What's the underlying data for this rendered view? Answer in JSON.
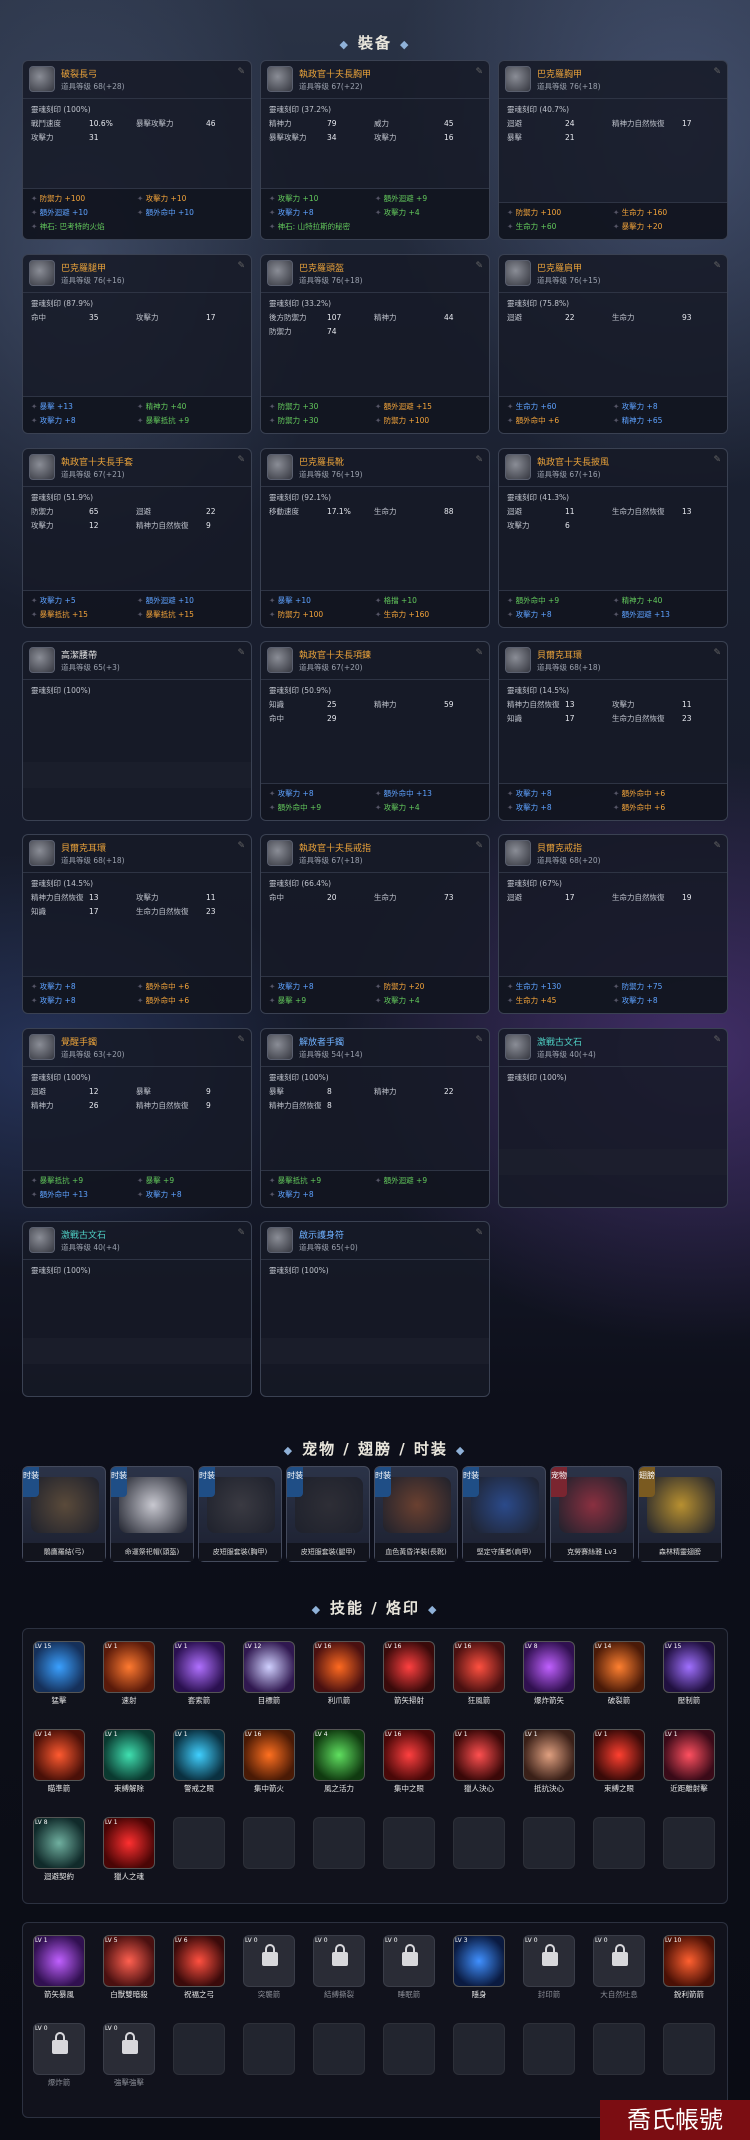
{
  "sections": {
    "equipment": "裝备",
    "pets": "宠物 / 翅膀 / 时装",
    "skills": "技能 / 烙印"
  },
  "cards": [
    {
      "name": "破裂長弓",
      "color": "orange",
      "level_label": "道具等级",
      "level": "68(+28)",
      "rune_pct": "靈魂刻印 (100%)",
      "stats": [
        [
          "戰鬥速度",
          "10.6%",
          "暴擊攻擊力",
          "46"
        ],
        [
          "攻擊力",
          "31",
          "",
          ""
        ]
      ],
      "bonus": [
        [
          "o",
          "防禦力 +100"
        ],
        [
          "o",
          "攻擊力 +10"
        ],
        [
          "bl",
          "額外迴避 +10"
        ],
        [
          "bl",
          "額外命中 +10"
        ],
        [
          "g",
          "神石: 巴考特的火焰"
        ]
      ]
    },
    {
      "name": "執政官十夫長胸甲",
      "color": "orange",
      "level_label": "道具等级",
      "level": "67(+22)",
      "rune_pct": "靈魂刻印 (37.2%)",
      "stats": [
        [
          "精神力",
          "79",
          "威力",
          "45"
        ],
        [
          "暴擊攻擊力",
          "34",
          "攻擊力",
          "16"
        ]
      ],
      "bonus": [
        [
          "g",
          "攻擊力 +10"
        ],
        [
          "g",
          "額外迴避 +9"
        ],
        [
          "bl",
          "攻擊力 +8"
        ],
        [
          "g",
          "攻擊力 +4"
        ],
        [
          "g",
          "神石: 山特拉斯的秘密"
        ]
      ]
    },
    {
      "name": "巴克羅胸甲",
      "color": "orange",
      "level_label": "道具等级",
      "level": "76(+18)",
      "rune_pct": "靈魂刻印 (40.7%)",
      "stats": [
        [
          "迴避",
          "24",
          "精神力自然恢復",
          "17"
        ],
        [
          "暴擊",
          "21",
          "",
          ""
        ]
      ],
      "bonus": [
        [
          "o",
          "防禦力 +100"
        ],
        [
          "o",
          "生命力 +160"
        ],
        [
          "g",
          "生命力 +60"
        ],
        [
          "o",
          "暴擊力 +20"
        ]
      ]
    },
    {
      "name": "巴克羅腿甲",
      "color": "orange",
      "level_label": "道具等级",
      "level": "76(+16)",
      "rune_pct": "靈魂刻印 (87.9%)",
      "stats": [
        [
          "命中",
          "35",
          "攻擊力",
          "17"
        ]
      ],
      "bonus": [
        [
          "bl",
          "暴擊 +13"
        ],
        [
          "g",
          "精神力 +40"
        ],
        [
          "bl",
          "攻擊力 +8"
        ],
        [
          "g",
          "暴擊抵抗 +9"
        ]
      ]
    },
    {
      "name": "巴克羅頭盔",
      "color": "orange",
      "level_label": "道具等级",
      "level": "76(+18)",
      "rune_pct": "靈魂刻印 (33.2%)",
      "stats": [
        [
          "後方防禦力",
          "107",
          "精神力",
          "44"
        ],
        [
          "防禦力",
          "74",
          "",
          ""
        ]
      ],
      "bonus": [
        [
          "g",
          "防禦力 +30"
        ],
        [
          "o",
          "額外迴避 +15"
        ],
        [
          "g",
          "防禦力 +30"
        ],
        [
          "o",
          "防禦力 +100"
        ]
      ]
    },
    {
      "name": "巴克羅肩甲",
      "color": "orange",
      "level_label": "道具等级",
      "level": "76(+15)",
      "rune_pct": "靈魂刻印 (75.8%)",
      "stats": [
        [
          "迴避",
          "22",
          "生命力",
          "93"
        ]
      ],
      "bonus": [
        [
          "bl",
          "生命力 +60"
        ],
        [
          "bl",
          "攻擊力 +8"
        ],
        [
          "o",
          "額外命中 +6"
        ],
        [
          "bl",
          "精神力 +65"
        ]
      ]
    },
    {
      "name": "執政官十夫長手套",
      "color": "orange",
      "level_label": "道具等级",
      "level": "67(+21)",
      "rune_pct": "靈魂刻印 (51.9%)",
      "stats": [
        [
          "防禦力",
          "65",
          "迴避",
          "22"
        ],
        [
          "攻擊力",
          "12",
          "精神力自然恢復",
          "9"
        ]
      ],
      "bonus": [
        [
          "bl",
          "攻擊力 +5"
        ],
        [
          "bl",
          "額外迴避 +10"
        ],
        [
          "o",
          "暴擊抵抗 +15"
        ],
        [
          "o",
          "暴擊抵抗 +15"
        ]
      ]
    },
    {
      "name": "巴克羅長靴",
      "color": "orange",
      "level_label": "道具等级",
      "level": "76(+19)",
      "rune_pct": "靈魂刻印 (92.1%)",
      "stats": [
        [
          "移動速度",
          "17.1%",
          "生命力",
          "88"
        ]
      ],
      "bonus": [
        [
          "bl",
          "暴擊 +10"
        ],
        [
          "g",
          "格擋 +10"
        ],
        [
          "o",
          "防禦力 +100"
        ],
        [
          "o",
          "生命力 +160"
        ]
      ]
    },
    {
      "name": "執政官十夫長披風",
      "color": "orange",
      "level_label": "道具等级",
      "level": "67(+16)",
      "rune_pct": "靈魂刻印 (41.3%)",
      "stats": [
        [
          "迴避",
          "11",
          "生命力自然恢復",
          "13"
        ],
        [
          "攻擊力",
          "6",
          "",
          ""
        ]
      ],
      "bonus": [
        [
          "g",
          "額外命中 +9"
        ],
        [
          "g",
          "精神力 +40"
        ],
        [
          "bl",
          "攻擊力 +8"
        ],
        [
          "bl",
          "額外迴避 +13"
        ]
      ]
    },
    {
      "name": "高潔腰帶",
      "color": "white",
      "level_label": "道具等级",
      "level": "65(+3)",
      "rune_pct": "靈魂刻印 (100%)",
      "stats": [],
      "bonus": []
    },
    {
      "name": "執政官十夫長項鍊",
      "color": "orange",
      "level_label": "道具等级",
      "level": "67(+20)",
      "rune_pct": "靈魂刻印 (50.9%)",
      "stats": [
        [
          "知識",
          "25",
          "精神力",
          "59"
        ],
        [
          "命中",
          "29",
          "",
          ""
        ]
      ],
      "bonus": [
        [
          "bl",
          "攻擊力 +8"
        ],
        [
          "bl",
          "額外命中 +13"
        ],
        [
          "g",
          "額外命中 +9"
        ],
        [
          "g",
          "攻擊力 +4"
        ]
      ]
    },
    {
      "name": "貝爾克耳環",
      "color": "orange",
      "level_label": "道具等级",
      "level": "68(+18)",
      "rune_pct": "靈魂刻印 (14.5%)",
      "stats": [
        [
          "精神力自然恢復",
          "13",
          "攻擊力",
          "11"
        ],
        [
          "知識",
          "17",
          "生命力自然恢復",
          "23"
        ]
      ],
      "bonus": [
        [
          "bl",
          "攻擊力 +8"
        ],
        [
          "o",
          "額外命中 +6"
        ],
        [
          "bl",
          "攻擊力 +8"
        ],
        [
          "o",
          "額外命中 +6"
        ]
      ]
    },
    {
      "name": "貝爾克耳環",
      "color": "orange",
      "level_label": "道具等级",
      "level": "68(+18)",
      "rune_pct": "靈魂刻印 (14.5%)",
      "stats": [
        [
          "精神力自然恢復",
          "13",
          "攻擊力",
          "11"
        ],
        [
          "知識",
          "17",
          "生命力自然恢復",
          "23"
        ]
      ],
      "bonus": [
        [
          "bl",
          "攻擊力 +8"
        ],
        [
          "o",
          "額外命中 +6"
        ],
        [
          "bl",
          "攻擊力 +8"
        ],
        [
          "o",
          "額外命中 +6"
        ]
      ]
    },
    {
      "name": "執政官十夫長戒指",
      "color": "orange",
      "level_label": "道具等级",
      "level": "67(+18)",
      "rune_pct": "靈魂刻印 (66.4%)",
      "stats": [
        [
          "命中",
          "20",
          "生命力",
          "73"
        ]
      ],
      "bonus": [
        [
          "bl",
          "攻擊力 +8"
        ],
        [
          "o",
          "防禦力 +20"
        ],
        [
          "g",
          "暴擊 +9"
        ],
        [
          "g",
          "攻擊力 +4"
        ]
      ]
    },
    {
      "name": "貝爾克戒指",
      "color": "orange",
      "level_label": "道具等级",
      "level": "68(+20)",
      "rune_pct": "靈魂刻印 (67%)",
      "stats": [
        [
          "迴避",
          "17",
          "生命力自然恢復",
          "19"
        ]
      ],
      "bonus": [
        [
          "bl",
          "生命力 +130"
        ],
        [
          "bl",
          "防禦力 +75"
        ],
        [
          "o",
          "生命力 +45"
        ],
        [
          "bl",
          "攻擊力 +8"
        ]
      ]
    },
    {
      "name": "覺醒手鐲",
      "color": "orange",
      "level_label": "道具等级",
      "level": "63(+20)",
      "rune_pct": "靈魂刻印 (100%)",
      "stats": [
        [
          "迴避",
          "12",
          "暴擊",
          "9"
        ],
        [
          "精神力",
          "26",
          "精神力自然恢復",
          "9"
        ]
      ],
      "bonus": [
        [
          "g",
          "暴擊抵抗 +9"
        ],
        [
          "g",
          "暴擊 +9"
        ],
        [
          "bl",
          "額外命中 +13"
        ],
        [
          "bl",
          "攻擊力 +8"
        ]
      ]
    },
    {
      "name": "解放者手鐲",
      "color": "blue",
      "level_label": "道具等级",
      "level": "54(+14)",
      "rune_pct": "靈魂刻印 (100%)",
      "stats": [
        [
          "暴擊",
          "8",
          "精神力",
          "22"
        ],
        [
          "精神力自然恢復",
          "8",
          "",
          ""
        ]
      ],
      "bonus": [
        [
          "g",
          "暴擊抵抗 +9"
        ],
        [
          "g",
          "額外迴避 +9"
        ],
        [
          "bl",
          "攻擊力 +8"
        ]
      ]
    },
    {
      "name": "激戰古文石",
      "color": "teal",
      "level_label": "道具等级",
      "level": "40(+4)",
      "rune_pct": "靈魂刻印 (100%)",
      "stats": [],
      "bonus": []
    },
    {
      "name": "激戰古文石",
      "color": "teal",
      "level_label": "道具等级",
      "level": "40(+4)",
      "rune_pct": "靈魂刻印 (100%)",
      "stats": [],
      "bonus": []
    },
    {
      "name": "啟示護身符",
      "color": "blue",
      "level_label": "道具等级",
      "level": "65(+0)",
      "rune_pct": "靈魂刻印 (100%)",
      "stats": [],
      "bonus": []
    }
  ],
  "pets": [
    {
      "tag": "时装",
      "name": "鵰鷹羅結(弓)",
      "art": "#5a4a3a"
    },
    {
      "tag": "时装",
      "name": "命運祭祀帽(頭盔)",
      "art": "#c8c8d0"
    },
    {
      "tag": "时装",
      "name": "皮短服套裝(胸甲)",
      "art": "#3a3a42"
    },
    {
      "tag": "时装",
      "name": "皮短服套裝(腿甲)",
      "art": "#2e2e36"
    },
    {
      "tag": "时装",
      "name": "血色黃昏洋裝(長靴)",
      "art": "#6a4030"
    },
    {
      "tag": "时装",
      "name": "堅定守護者(肩甲)",
      "art": "#2b4a8a"
    },
    {
      "tag": "宠物",
      "name": "克勞賽絲雅 Lv3",
      "art": "#8a3040"
    },
    {
      "tag": "翅膀",
      "name": "森林精靈翅膀",
      "art": "#b89030"
    }
  ],
  "skills_main": [
    {
      "lv": "LV 15",
      "name": "猛擊",
      "c1": "#3aa0ff",
      "c2": "#15305a"
    },
    {
      "lv": "LV 1",
      "name": "速射",
      "c1": "#ff7a30",
      "c2": "#5a1a0a"
    },
    {
      "lv": "LV 1",
      "name": "套索箭",
      "c1": "#b070ff",
      "c2": "#2a1050"
    },
    {
      "lv": "LV 12",
      "name": "目標箭",
      "c1": "#d0d0ff",
      "c2": "#301850"
    },
    {
      "lv": "LV 16",
      "name": "利爪箭",
      "c1": "#ff6a20",
      "c2": "#4a1010"
    },
    {
      "lv": "LV 16",
      "name": "箭矢掃射",
      "c1": "#ff4040",
      "c2": "#3a0a0a"
    },
    {
      "lv": "LV 16",
      "name": "狂風箭",
      "c1": "#ff5040",
      "c2": "#4a1010"
    },
    {
      "lv": "LV 8",
      "name": "爆炸箭矢",
      "c1": "#c060ff",
      "c2": "#301050"
    },
    {
      "lv": "LV 14",
      "name": "破裂箭",
      "c1": "#ff8030",
      "c2": "#4a1a08"
    },
    {
      "lv": "LV 15",
      "name": "壓制箭",
      "c1": "#a070ff",
      "c2": "#201040"
    },
    {
      "lv": "LV 14",
      "name": "瞄準箭",
      "c1": "#ff5a30",
      "c2": "#4a1008"
    },
    {
      "lv": "LV 1",
      "name": "束縛解除",
      "c1": "#40e0b0",
      "c2": "#0a3a30"
    },
    {
      "lv": "LV 1",
      "name": "警戒之眼",
      "c1": "#40d0ff",
      "c2": "#0a3040"
    },
    {
      "lv": "LV 16",
      "name": "集中箭火",
      "c1": "#ff7020",
      "c2": "#4a1a05"
    },
    {
      "lv": "LV 4",
      "name": "風之活力",
      "c1": "#60e060",
      "c2": "#103a10"
    },
    {
      "lv": "LV 16",
      "name": "集中之眼",
      "c1": "#ff4040",
      "c2": "#4a0808"
    },
    {
      "lv": "LV 1",
      "name": "獵人決心",
      "c1": "#ff5050",
      "c2": "#3a0808"
    },
    {
      "lv": "LV 1",
      "name": "抵抗決心",
      "c1": "#e0a080",
      "c2": "#3a2018"
    },
    {
      "lv": "LV 1",
      "name": "束縛之眼",
      "c1": "#ff4030",
      "c2": "#3a0a08"
    },
    {
      "lv": "LV 1",
      "name": "近距離射擊",
      "c1": "#ff5060",
      "c2": "#3a0a18"
    },
    {
      "lv": "LV 8",
      "name": "迴避契約",
      "c1": "#70b0a0",
      "c2": "#102a2a"
    },
    {
      "lv": "LV 1",
      "name": "獵人之魂",
      "c1": "#ff3030",
      "c2": "#4a0505"
    }
  ],
  "skills_stigma": [
    {
      "lv": "LV 1",
      "name": "箭矢暴風",
      "c1": "#c060ff",
      "c2": "#301050",
      "locked": false
    },
    {
      "lv": "LV 5",
      "name": "白獸雙暗殺",
      "c1": "#ff6050",
      "c2": "#4a1010",
      "locked": false
    },
    {
      "lv": "LV 6",
      "name": "祝福之弓",
      "c1": "#ff5040",
      "c2": "#3a0a0a",
      "locked": false
    },
    {
      "lv": "LV 0",
      "name": "突襲箭",
      "locked": true
    },
    {
      "lv": "LV 0",
      "name": "結縛撕裂",
      "locked": true
    },
    {
      "lv": "LV 0",
      "name": "睡眠箭",
      "locked": true
    },
    {
      "lv": "LV 3",
      "name": "隱身",
      "c1": "#4090ff",
      "c2": "#0a1a40",
      "locked": false
    },
    {
      "lv": "LV 0",
      "name": "封印箭",
      "locked": true
    },
    {
      "lv": "LV 0",
      "name": "大自然吐息",
      "locked": true
    },
    {
      "lv": "LV 10",
      "name": "銳利箭箭",
      "c1": "#ff6030",
      "c2": "#4a1005",
      "locked": false
    },
    {
      "lv": "LV 0",
      "name": "爆炸箭",
      "locked": true
    },
    {
      "lv": "LV 0",
      "name": "強擊強擊",
      "locked": true
    }
  ],
  "watermark": "喬氏帳號"
}
